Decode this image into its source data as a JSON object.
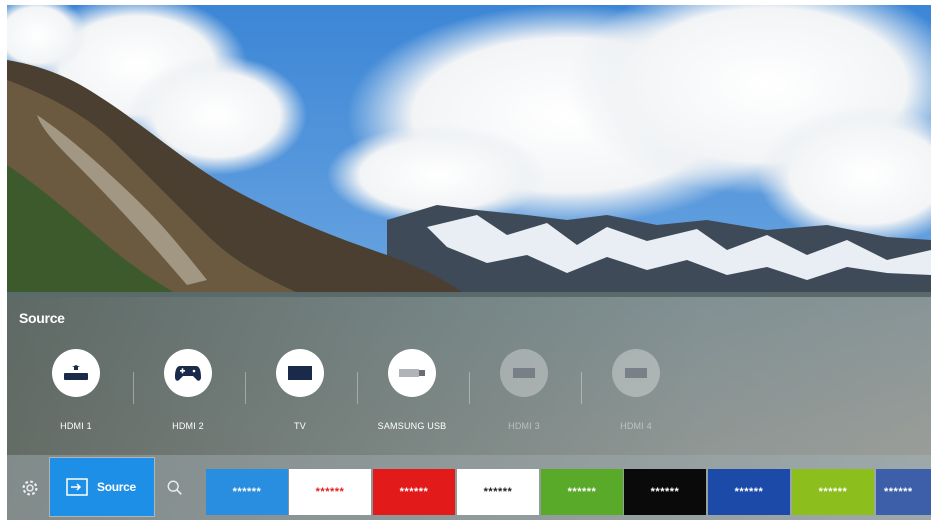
{
  "source_panel": {
    "title": "Source",
    "items": [
      {
        "label": "HDMI 1",
        "icon": "bluray-player-icon",
        "dim": false
      },
      {
        "label": "HDMI 2",
        "icon": "game-controller-icon",
        "dim": false
      },
      {
        "label": "TV",
        "icon": "tv-icon",
        "dim": false
      },
      {
        "label": "SAMSUNG USB",
        "icon": "usb-drive-icon",
        "dim": false
      },
      {
        "label": "HDMI 3",
        "icon": "hdmi-port-icon",
        "dim": true
      },
      {
        "label": "HDMI 4",
        "icon": "hdmi-port-icon",
        "dim": true
      }
    ]
  },
  "dock": {
    "settings_icon": "gear-icon",
    "source_button": {
      "label": "Source",
      "icon": "source-input-icon"
    },
    "search_icon": "search-icon",
    "tiles": [
      {
        "label": "******",
        "bg": "#2a8ee0",
        "fg": "#ffffff"
      },
      {
        "label": "******",
        "bg": "#ffffff",
        "fg": "#e02020"
      },
      {
        "label": "******",
        "bg": "#e21a1a",
        "fg": "#ffffff"
      },
      {
        "label": "******",
        "bg": "#ffffff",
        "fg": "#222222"
      },
      {
        "label": "******",
        "bg": "#5aaa2a",
        "fg": "#ffffff"
      },
      {
        "label": "******",
        "bg": "#0a0a0a",
        "fg": "#ffffff"
      },
      {
        "label": "******",
        "bg": "#1c4aa8",
        "fg": "#ffffff"
      },
      {
        "label": "******",
        "bg": "#8cbf1e",
        "fg": "#ffffff"
      },
      {
        "label": "******",
        "bg": "#3d5ea8",
        "fg": "#ffffff"
      }
    ]
  },
  "colors": {
    "accent": "#1e8fe6"
  }
}
